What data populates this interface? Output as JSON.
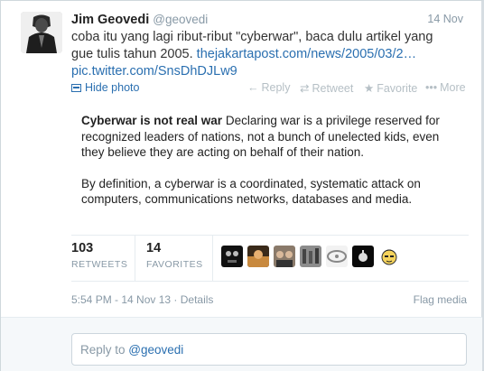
{
  "tweet": {
    "author_name": "Jim Geovedi",
    "author_handle": "@geovedi",
    "timestamp": "14 Nov",
    "text_line1": "coba itu yang lagi ribut-ribut \"cyberwar\", baca dulu artikel yang",
    "text_line2": "gue tulis tahun 2005. ",
    "link1": "thejakartapost.com/news/2005/03/2…",
    "link2": "pic.twitter.com/SnsDhDJLw9"
  },
  "actions": {
    "hide_photo": "Hide photo",
    "reply": "Reply",
    "retweet": "Retweet",
    "favorite": "Favorite",
    "more": "More"
  },
  "photo": {
    "heading": "Cyberwar is not real war",
    "para1": " Declaring war is a privilege reserved for recognized leaders of nations, not a bunch of unelected kids, even they believe they are acting on behalf of their nation.",
    "para2": "By definition, a cyberwar is a coordinated, systematic attack on computers, communications networks, databases and media."
  },
  "stats": {
    "retweets_count": "103",
    "retweets_label": "RETWEETS",
    "favorites_count": "14",
    "favorites_label": "FAVORITES"
  },
  "footer": {
    "datetime": "5:54 PM - 14 Nov 13",
    "separator": " · ",
    "details": "Details",
    "flag": "Flag media"
  },
  "reply": {
    "prefix": "Reply to ",
    "mention": "@geovedi"
  },
  "icons": {
    "reply": "reply-arrow-icon",
    "retweet": "retweet-icon",
    "favorite": "star-icon",
    "more": "more-dots-icon",
    "photo": "photo-icon"
  },
  "colors": {
    "link": "#2a6fb0",
    "muted": "#8899a6",
    "action_disabled": "#b5bfc5"
  }
}
